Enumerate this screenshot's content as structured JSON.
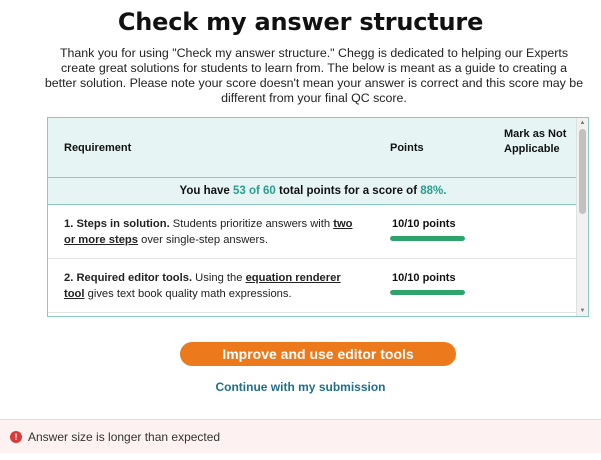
{
  "page": {
    "title": "Check my answer structure",
    "intro": "Thank you for using \"Check my answer structure.\" Chegg is dedicated to helping our Experts create great solutions for students to learn from. The below is meant as a guide to creating a better solution. Please note your score doesn't mean your answer is correct and this score may be different from your final QC score."
  },
  "table": {
    "headers": {
      "requirement": "Requirement",
      "points": "Points",
      "mark_na": "Mark as Not Applicable"
    },
    "summary": {
      "prefix": "You have ",
      "earned": "53 of 60",
      "middle": " total points for a score of ",
      "score": "88%."
    },
    "rows": [
      {
        "number": "1.",
        "title": "Steps in solution.",
        "text_before": " Students prioritize answers with ",
        "link": "two or more steps",
        "text_after": " over single-step answers.",
        "points": "10/10 points",
        "fraction": 1.0
      },
      {
        "number": "2.",
        "title": "Required editor tools.",
        "text_before": " Using the ",
        "link": "equation renderer tool",
        "text_after": " gives text book quality math expressions.",
        "points": "10/10 points",
        "fraction": 1.0
      }
    ]
  },
  "actions": {
    "primary": "Improve and use editor tools",
    "secondary": "Continue with my submission"
  },
  "alert": {
    "icon": "!",
    "message": "Answer size is longer than expected"
  },
  "colors": {
    "accent_teal": "#2a9d8f",
    "button_orange": "#ec7a1c",
    "progress_green": "#2ea36b",
    "error_red": "#d93a3a"
  }
}
